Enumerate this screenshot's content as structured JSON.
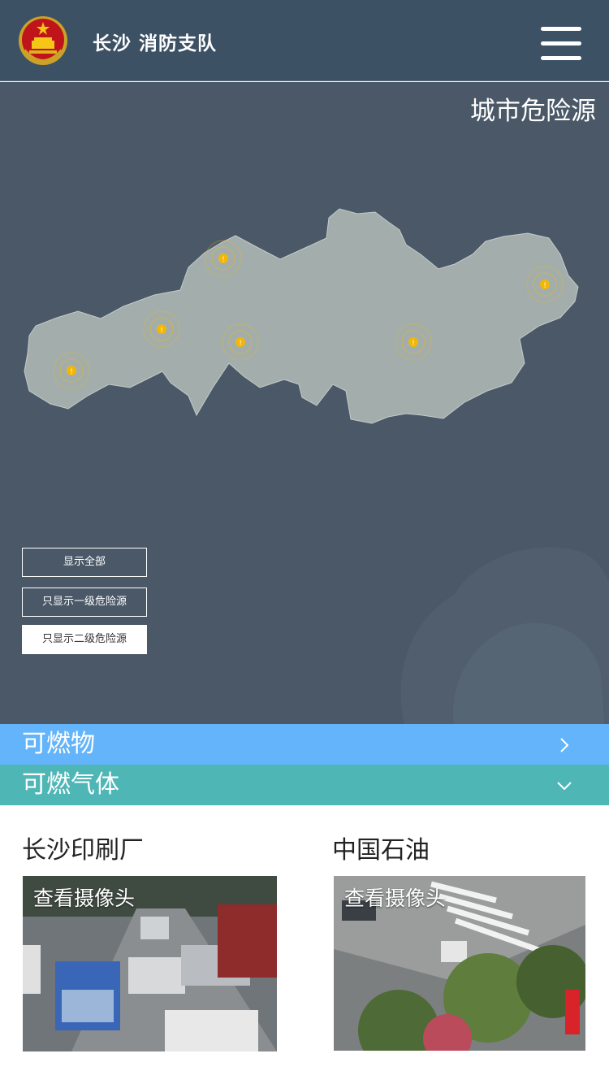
{
  "header": {
    "title": "长沙 消防支队",
    "emblem_icon": "national-emblem-icon",
    "menu_icon": "hamburger-menu-icon"
  },
  "map_section": {
    "title": "城市危险源",
    "hazard_marker_icon": "warning-marker-icon",
    "hazard_marker_color": "#f2b705",
    "filters": {
      "show_all": "显示全部",
      "show_level_1": "只显示一级危险源",
      "show_level_2": "只显示二级危险源",
      "selected": "只显示二级危险源"
    }
  },
  "categories": [
    {
      "label": "可燃物",
      "icon": "chevron-right-icon",
      "color": "#63b4fa"
    },
    {
      "label": "可燃气体",
      "icon": "chevron-down-icon",
      "color": "#4fb6b6"
    }
  ],
  "sites": [
    {
      "name": "长沙印刷厂",
      "camera_label": "查看摄像头"
    },
    {
      "name": "中国石油",
      "camera_label": "查看摄像头"
    }
  ]
}
